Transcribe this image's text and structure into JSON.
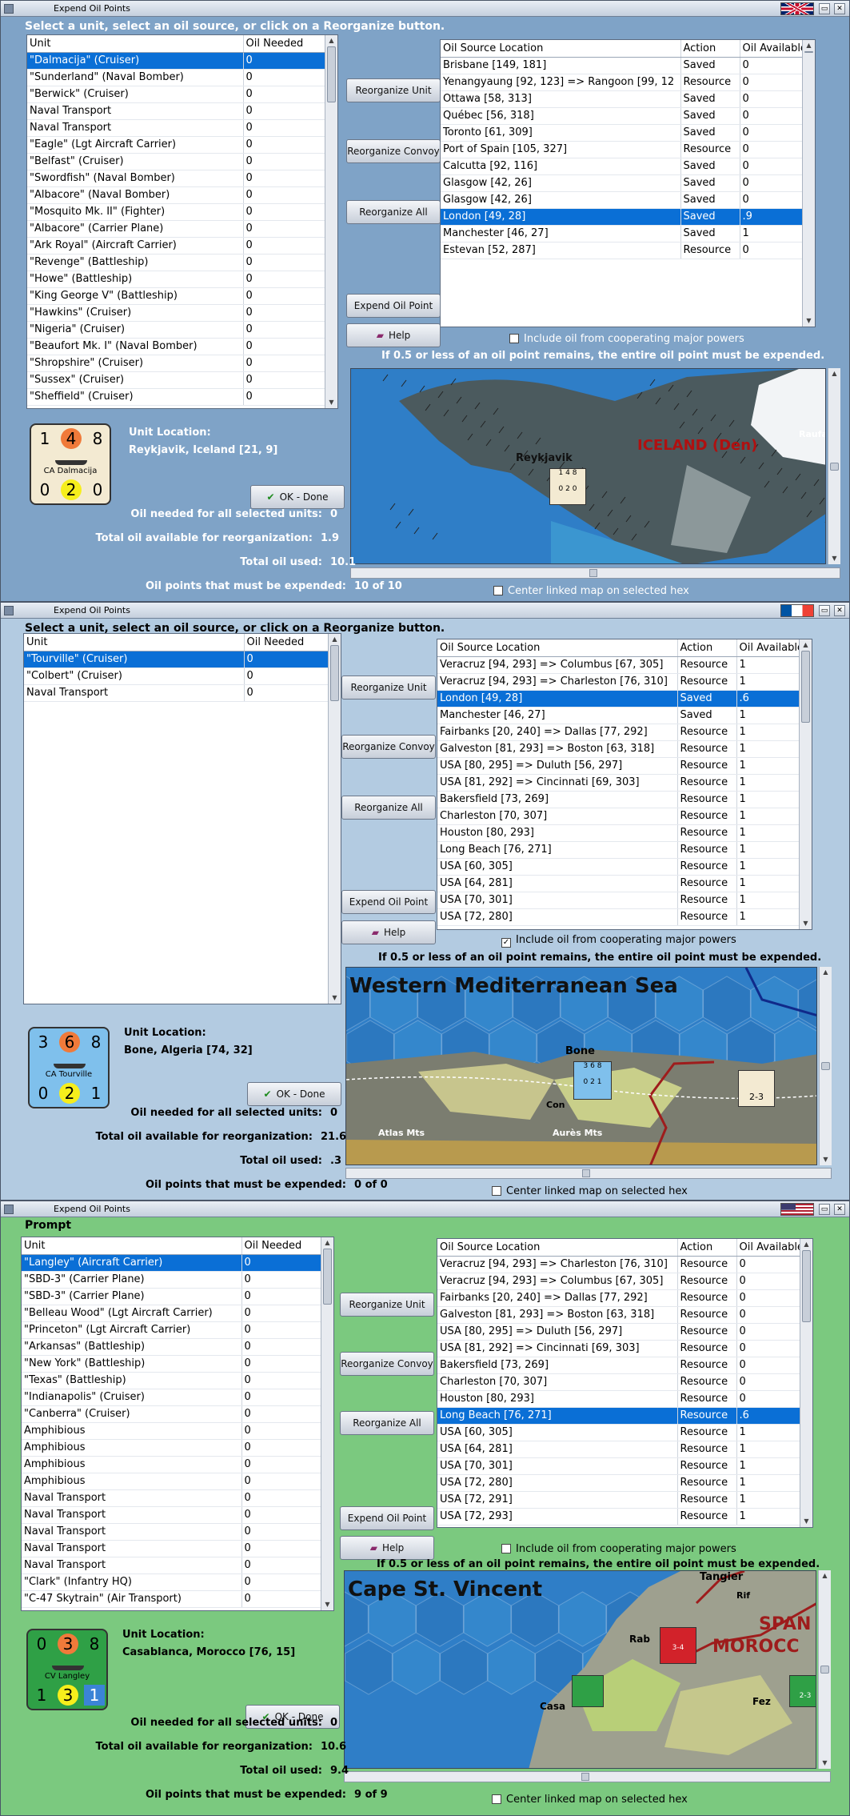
{
  "windows": [
    {
      "title": "Expend Oil Points",
      "flag": "uk",
      "instruction": "Select a unit, select an oil source, or click on a Reorganize button.",
      "units": {
        "headers": [
          "Unit",
          "Oil Needed"
        ],
        "rows": [
          [
            "\"Dalmacija\" (Cruiser)",
            "0"
          ],
          [
            "\"Sunderland\" (Naval Bomber)",
            "0"
          ],
          [
            "\"Berwick\" (Cruiser)",
            "0"
          ],
          [
            "Naval Transport",
            "0"
          ],
          [
            "Naval Transport",
            "0"
          ],
          [
            "\"Eagle\" (Lgt Aircraft Carrier)",
            "0"
          ],
          [
            "\"Belfast\" (Cruiser)",
            "0"
          ],
          [
            "\"Swordfish\" (Naval Bomber)",
            "0"
          ],
          [
            "\"Albacore\" (Naval Bomber)",
            "0"
          ],
          [
            "\"Mosquito Mk. II\" (Fighter)",
            "0"
          ],
          [
            "\"Albacore\" (Carrier Plane)",
            "0"
          ],
          [
            "\"Ark Royal\" (Aircraft Carrier)",
            "0"
          ],
          [
            "\"Revenge\" (Battleship)",
            "0"
          ],
          [
            "\"Howe\" (Battleship)",
            "0"
          ],
          [
            "\"King George V\" (Battleship)",
            "0"
          ],
          [
            "\"Hawkins\" (Cruiser)",
            "0"
          ],
          [
            "\"Nigeria\" (Cruiser)",
            "0"
          ],
          [
            "\"Beaufort Mk. I\" (Naval Bomber)",
            "0"
          ],
          [
            "\"Shropshire\" (Cruiser)",
            "0"
          ],
          [
            "\"Sussex\" (Cruiser)",
            "0"
          ],
          [
            "\"Sheffield\" (Cruiser)",
            "0"
          ]
        ]
      },
      "sources": {
        "headers": [
          "Oil Source Location",
          "Action",
          "Oil Available"
        ],
        "rows": [
          [
            "Brisbane [149, 181]",
            "Saved",
            "0"
          ],
          [
            "Yenangyaung [92, 123] => Rangoon [99, 12",
            "Resource",
            "0"
          ],
          [
            "Ottawa [58, 313]",
            "Saved",
            "0"
          ],
          [
            "Québec [56, 318]",
            "Saved",
            "0"
          ],
          [
            "Toronto [61, 309]",
            "Saved",
            "0"
          ],
          [
            "Port of Spain [105, 327]",
            "Resource",
            "0"
          ],
          [
            "Calcutta [92, 116]",
            "Saved",
            "0"
          ],
          [
            "Glasgow [42, 26]",
            "Saved",
            "0"
          ],
          [
            "Glasgow [42, 26]",
            "Saved",
            "0"
          ],
          [
            "London [49, 28]",
            "Saved",
            ".9"
          ],
          [
            "Manchester [46, 27]",
            "Saved",
            "1"
          ],
          [
            "Estevan [52, 287]",
            "Resource",
            "0"
          ]
        ]
      },
      "buttons": {
        "reorg_unit": "Reorganize Unit",
        "reorg_convoy": "Reorganize Convoy",
        "reorg_all": "Reorganize All",
        "expend": "Expend Oil Point",
        "help": "Help",
        "ok": "OK - Done"
      },
      "include_coop": {
        "label": "Include oil from cooperating major powers",
        "checked": false
      },
      "note": "If 0.5 or less of an oil point remains, the entire oil point must be expended.",
      "counter": {
        "tl": "1",
        "tm": "4",
        "tr": "8",
        "bl": "0",
        "bm": "2",
        "br": "0",
        "name": "CA Dalmacija"
      },
      "location": {
        "label": "Unit Location:",
        "value": "Reykjavik, Iceland [21, 9]"
      },
      "stats": [
        [
          "Oil needed for all selected units:",
          "0"
        ],
        [
          "Total oil available for reorganization:",
          "1.9"
        ],
        [
          "Total oil used:",
          "10.1"
        ],
        [
          "Oil points that must be expended:",
          "10 of 10"
        ]
      ],
      "map": {
        "title": "",
        "labels": [
          "Reykjavik",
          "ICELAND (Den)",
          "Raufa"
        ]
      },
      "center_map": {
        "label": "Center linked map on selected hex",
        "checked": false
      }
    },
    {
      "title": "Expend Oil Points",
      "flag": "fr",
      "instruction": "Select a unit, select an oil source, or click on a Reorganize button.",
      "units": {
        "headers": [
          "Unit",
          "Oil Needed"
        ],
        "rows": [
          [
            "\"Tourville\" (Cruiser)",
            "0"
          ],
          [
            "\"Colbert\" (Cruiser)",
            "0"
          ],
          [
            "Naval Transport",
            "0"
          ]
        ]
      },
      "sources": {
        "headers": [
          "Oil Source Location",
          "Action",
          "Oil Available"
        ],
        "rows": [
          [
            "Veracruz [94, 293] => Columbus [67, 305]",
            "Resource",
            "1"
          ],
          [
            "Veracruz [94, 293] => Charleston [76, 310]",
            "Resource",
            "1"
          ],
          [
            "London [49, 28]",
            "Saved",
            ".6"
          ],
          [
            "Manchester [46, 27]",
            "Saved",
            "1"
          ],
          [
            "Fairbanks [20, 240] => Dallas [77, 292]",
            "Resource",
            "1"
          ],
          [
            "Galveston [81, 293] => Boston [63, 318]",
            "Resource",
            "1"
          ],
          [
            "USA [80, 295] => Duluth [56, 297]",
            "Resource",
            "1"
          ],
          [
            "USA [81, 292] => Cincinnati [69, 303]",
            "Resource",
            "1"
          ],
          [
            "Bakersfield [73, 269]",
            "Resource",
            "1"
          ],
          [
            "Charleston [70, 307]",
            "Resource",
            "1"
          ],
          [
            "Houston [80, 293]",
            "Resource",
            "1"
          ],
          [
            "Long Beach [76, 271]",
            "Resource",
            "1"
          ],
          [
            "USA [60, 305]",
            "Resource",
            "1"
          ],
          [
            "USA [64, 281]",
            "Resource",
            "1"
          ],
          [
            "USA [70, 301]",
            "Resource",
            "1"
          ],
          [
            "USA [72, 280]",
            "Resource",
            "1"
          ]
        ]
      },
      "buttons": {
        "reorg_unit": "Reorganize Unit",
        "reorg_convoy": "Reorganize Convoy",
        "reorg_all": "Reorganize All",
        "expend": "Expend Oil Point",
        "help": "Help",
        "ok": "OK - Done"
      },
      "include_coop": {
        "label": "Include oil from cooperating major powers",
        "checked": true
      },
      "note": "If 0.5 or less of an oil point remains, the entire oil point must be expended.",
      "counter": {
        "tl": "3",
        "tm": "6",
        "tr": "8",
        "bl": "0",
        "bm": "2",
        "br": "1",
        "name": "CA Tourville"
      },
      "location": {
        "label": "Unit Location:",
        "value": "Bone, Algeria [74, 32]"
      },
      "stats": [
        [
          "Oil needed for all selected units:",
          "0"
        ],
        [
          "Total oil available for reorganization:",
          "21.6"
        ],
        [
          "Total oil used:",
          ".3"
        ],
        [
          "Oil points that must be expended:",
          "0 of 0"
        ]
      ],
      "map": {
        "title": "Western Mediterranean Sea",
        "labels": [
          "Bone",
          "Atlas Mts",
          "Aurès Mts",
          "Con",
          "2-3"
        ]
      },
      "center_map": {
        "label": "Center linked map on selected hex",
        "checked": false
      }
    },
    {
      "title": "Expend Oil Points",
      "flag": "us",
      "instruction": "Prompt",
      "units": {
        "headers": [
          "Unit",
          "Oil Needed"
        ],
        "rows": [
          [
            "\"Langley\" (Aircraft Carrier)",
            "0"
          ],
          [
            "\"SBD-3\" (Carrier Plane)",
            "0"
          ],
          [
            "\"SBD-3\" (Carrier Plane)",
            "0"
          ],
          [
            "\"Belleau Wood\" (Lgt Aircraft Carrier)",
            "0"
          ],
          [
            "\"Princeton\" (Lgt Aircraft Carrier)",
            "0"
          ],
          [
            "\"Arkansas\" (Battleship)",
            "0"
          ],
          [
            "\"New York\" (Battleship)",
            "0"
          ],
          [
            "\"Texas\" (Battleship)",
            "0"
          ],
          [
            "\"Indianapolis\" (Cruiser)",
            "0"
          ],
          [
            "\"Canberra\" (Cruiser)",
            "0"
          ],
          [
            "Amphibious",
            "0"
          ],
          [
            "Amphibious",
            "0"
          ],
          [
            "Amphibious",
            "0"
          ],
          [
            "Amphibious",
            "0"
          ],
          [
            "Naval Transport",
            "0"
          ],
          [
            "Naval Transport",
            "0"
          ],
          [
            "Naval Transport",
            "0"
          ],
          [
            "Naval Transport",
            "0"
          ],
          [
            "Naval Transport",
            "0"
          ],
          [
            "\"Clark\" (Infantry HQ)",
            "0"
          ],
          [
            "\"C-47 Skytrain\" (Air Transport)",
            "0"
          ]
        ]
      },
      "sources": {
        "headers": [
          "Oil Source Location",
          "Action",
          "Oil Available"
        ],
        "rows": [
          [
            "Veracruz [94, 293] => Charleston [76, 310]",
            "Resource",
            "0"
          ],
          [
            "Veracruz [94, 293] => Columbus [67, 305]",
            "Resource",
            "0"
          ],
          [
            "Fairbanks [20, 240] => Dallas [77, 292]",
            "Resource",
            "0"
          ],
          [
            "Galveston [81, 293] => Boston [63, 318]",
            "Resource",
            "0"
          ],
          [
            "USA [80, 295] => Duluth [56, 297]",
            "Resource",
            "0"
          ],
          [
            "USA [81, 292] => Cincinnati [69, 303]",
            "Resource",
            "0"
          ],
          [
            "Bakersfield [73, 269]",
            "Resource",
            "0"
          ],
          [
            "Charleston [70, 307]",
            "Resource",
            "0"
          ],
          [
            "Houston [80, 293]",
            "Resource",
            "0"
          ],
          [
            "Long Beach [76, 271]",
            "Resource",
            ".6"
          ],
          [
            "USA [60, 305]",
            "Resource",
            "1"
          ],
          [
            "USA [64, 281]",
            "Resource",
            "1"
          ],
          [
            "USA [70, 301]",
            "Resource",
            "1"
          ],
          [
            "USA [72, 280]",
            "Resource",
            "1"
          ],
          [
            "USA [72, 291]",
            "Resource",
            "1"
          ],
          [
            "USA [72, 293]",
            "Resource",
            "1"
          ]
        ]
      },
      "buttons": {
        "reorg_unit": "Reorganize Unit",
        "reorg_convoy": "Reorganize Convoy",
        "reorg_all": "Reorganize All",
        "expend": "Expend Oil Point",
        "help": "Help",
        "ok": "OK - Done"
      },
      "include_coop": {
        "label": "Include oil from cooperating major powers",
        "checked": false
      },
      "note": "If 0.5 or less of an oil point remains, the entire oil point must be expended.",
      "counter": {
        "tl": "0",
        "tm": "3",
        "tr": "8",
        "bl": "1",
        "bm": "3",
        "br": "1",
        "name": "CV Langley"
      },
      "location": {
        "label": "Unit Location:",
        "value": "Casablanca, Morocco [76, 15]"
      },
      "stats": [
        [
          "Oil needed for all selected units:",
          "0"
        ],
        [
          "Total oil available for reorganization:",
          "10.6"
        ],
        [
          "Total oil used:",
          "9.4"
        ],
        [
          "Oil points that must be expended:",
          "9 of 9"
        ]
      ],
      "map": {
        "title": "Cape St. Vincent",
        "labels": [
          "Tangier",
          "Rif",
          "SPAN",
          "MOROCC",
          "Rab",
          "Casa",
          "Fez",
          "3-4",
          "2-3"
        ]
      },
      "center_map": {
        "label": "Center linked map on selected hex",
        "checked": false
      }
    }
  ]
}
